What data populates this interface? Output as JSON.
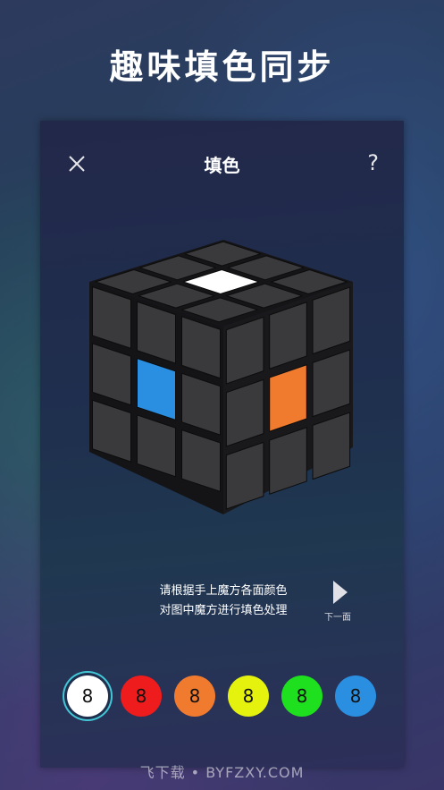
{
  "promo_title": "趣味填色同步",
  "header": {
    "title": "填色",
    "help_label": "?"
  },
  "instruction": {
    "line1": "请根据手上魔方各面颜色",
    "line2": "对图中魔方进行填色处理"
  },
  "next": {
    "label": "下一面"
  },
  "palette": [
    {
      "label": "8",
      "color": "#ffffff",
      "selected": true
    },
    {
      "label": "8",
      "color": "#ee1c1c",
      "selected": false
    },
    {
      "label": "8",
      "color": "#f07a2e",
      "selected": false
    },
    {
      "label": "8",
      "color": "#e4f20e",
      "selected": false
    },
    {
      "label": "8",
      "color": "#1ee01e",
      "selected": false
    },
    {
      "label": "8",
      "color": "#2a8fe0",
      "selected": false
    }
  ],
  "cube": {
    "top_center_color": "#ffffff",
    "left_center_color": "#2a8fe0",
    "right_center_color": "#f07a2e",
    "sticker_color": "#3a3a3c",
    "body_color": "#151517"
  },
  "watermark": "飞下载 • BYFZXY.COM"
}
